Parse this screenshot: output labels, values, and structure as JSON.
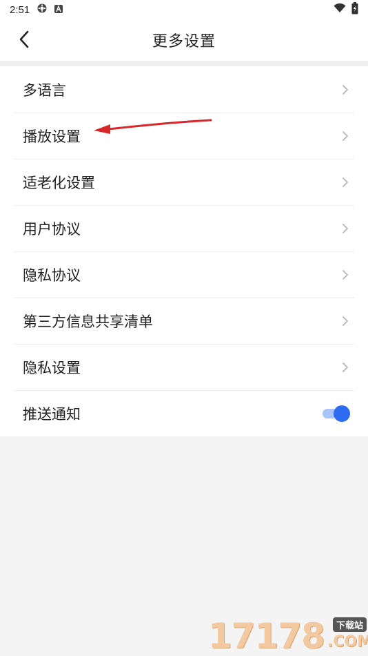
{
  "status_bar": {
    "time": "2:51",
    "left_icons": [
      "settings-gear-icon",
      "text-a-icon"
    ],
    "right_icons": [
      "wifi-icon",
      "battery-icon"
    ]
  },
  "header": {
    "title": "更多设置",
    "back_icon": "back-arrow-icon"
  },
  "menu": {
    "items": [
      {
        "label": "多语言",
        "type": "link"
      },
      {
        "label": "播放设置",
        "type": "link"
      },
      {
        "label": "适老化设置",
        "type": "link"
      },
      {
        "label": "用户协议",
        "type": "link"
      },
      {
        "label": "隐私协议",
        "type": "link"
      },
      {
        "label": "第三方信息共享清单",
        "type": "link"
      },
      {
        "label": "隐私设置",
        "type": "link"
      },
      {
        "label": "推送通知",
        "type": "toggle",
        "on": true
      }
    ]
  },
  "annotation": {
    "type": "red-arrow",
    "color": "#d9262b",
    "points_to": "播放设置"
  },
  "watermark": {
    "number": "17178",
    "tag": "下载站",
    "domain": ".COM"
  },
  "colors": {
    "accent": "#2d6cf0",
    "accent_light": "#a8c4f8",
    "page_bg": "#f4f4f4",
    "card_bg": "#ffffff",
    "chevron": "#b5b5b5"
  }
}
